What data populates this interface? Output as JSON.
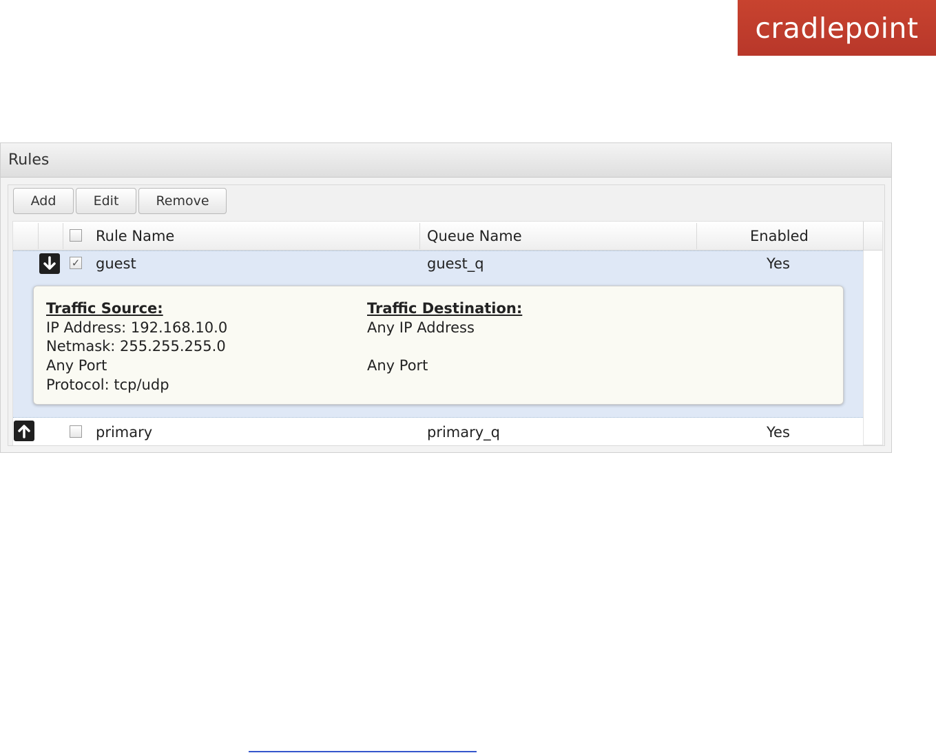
{
  "brand": {
    "logo_text": "cradlepoint",
    "color": "#c0392b"
  },
  "panel": {
    "title": "Rules",
    "toolbar": {
      "add_label": "Add",
      "edit_label": "Edit",
      "remove_label": "Remove"
    },
    "columns": {
      "rule_name": "Rule Name",
      "queue_name": "Queue Name",
      "enabled": "Enabled"
    },
    "rows": [
      {
        "rule_name": "guest",
        "queue_name": "guest_q",
        "enabled": "Yes",
        "checked": true,
        "arrow": "down-arrow-icon",
        "details": {
          "source_heading": "Traffic Source:",
          "source_ip": "IP Address: 192.168.10.0",
          "source_netmask": "Netmask: 255.255.255.0",
          "source_port": "Any Port",
          "source_protocol": "Protocol: tcp/udp",
          "dest_heading": "Traffic Destination:",
          "dest_ip": "Any IP Address",
          "dest_port": "Any Port"
        }
      },
      {
        "rule_name": "primary",
        "queue_name": "primary_q",
        "enabled": "Yes",
        "checked": false,
        "arrow": "up-arrow-icon"
      }
    ]
  },
  "checkmark": "✓"
}
